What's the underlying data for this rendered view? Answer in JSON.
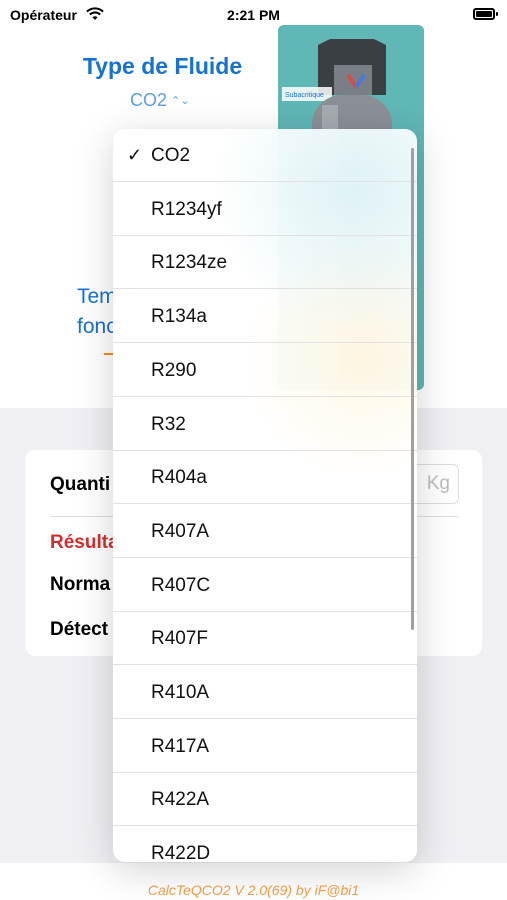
{
  "status_bar": {
    "carrier": "Opérateur",
    "time": "2:21 PM"
  },
  "main": {
    "fluid_title": "Type de Fluide",
    "fluid_selected": "CO2",
    "temp_label_line1": "Tem",
    "temp_label_line2": "fonc",
    "image_caption": "Subacritique"
  },
  "card": {
    "quantity_label": "Quanti",
    "kg_placeholder": "Kg",
    "result_label": "Résulta",
    "norm_label": "Norma",
    "detect_label": "Détect"
  },
  "dropdown": {
    "selected": "CO2",
    "options": [
      "CO2",
      "R1234yf",
      "R1234ze",
      "R134a",
      "R290",
      "R32",
      "R404a",
      "R407A",
      "R407C",
      "R407F",
      "R410A",
      "R417A",
      "R422A",
      "R422D"
    ]
  },
  "footer": {
    "version_text": "CalcTeQCO2 V 2.0(69) by iF@bi1"
  },
  "colors": {
    "accent": "#1672d6",
    "red": "#d32f2f",
    "footer": "#f0a04a",
    "cylinder_bg": "#5fb7b6"
  }
}
